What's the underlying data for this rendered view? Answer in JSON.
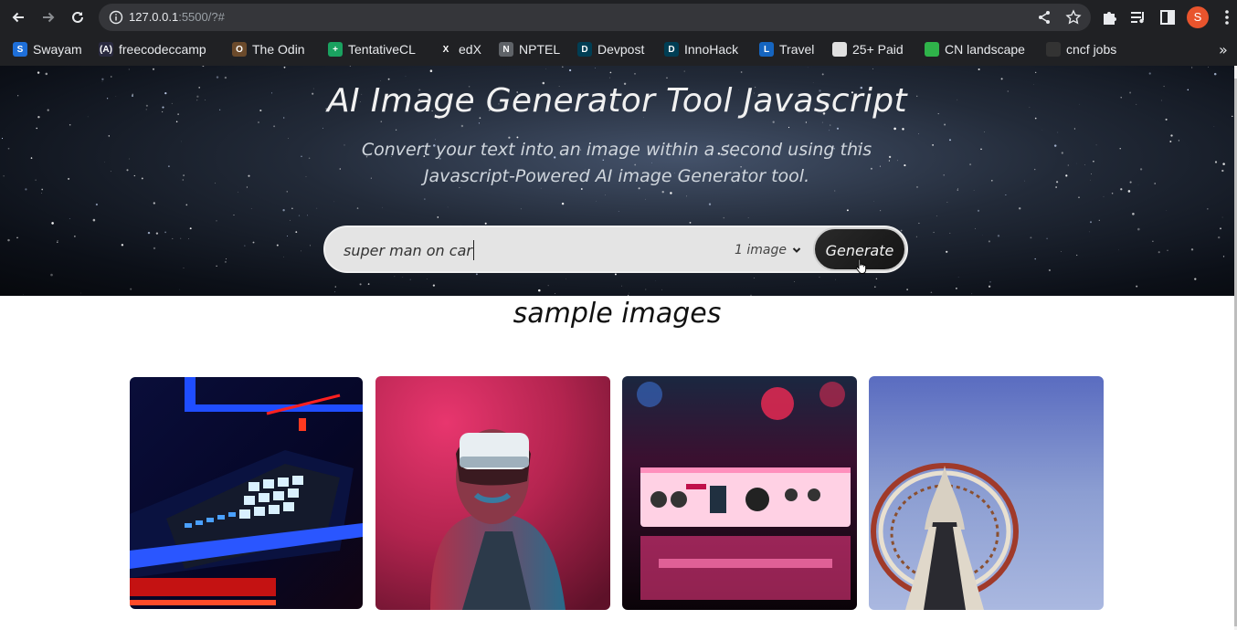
{
  "browser": {
    "url_host": "127.0.0.1",
    "url_rest": ":5500/?#",
    "profile_initial": "S",
    "icons": {
      "back": "back-arrow-icon",
      "forward": "forward-arrow-icon",
      "reload": "reload-icon",
      "info": "site-info-icon",
      "share": "share-icon",
      "bookmark": "star-icon",
      "extensions": "puzzle-icon",
      "media": "media-queue-icon",
      "sidepanel": "side-panel-icon",
      "menu": "kebab-menu-icon"
    },
    "bookmarks": [
      {
        "label": "Swayam",
        "icon": "swayam-icon",
        "color": "#1e6fd9",
        "glyph": "S"
      },
      {
        "label": "freecodeccamp",
        "icon": "freecodecamp-icon",
        "color": "#2a2a40",
        "glyph": "(A)"
      },
      {
        "label": "The Odin",
        "icon": "odin-icon",
        "color": "#6b4a2b",
        "glyph": "O"
      },
      {
        "label": "TentativeCL",
        "icon": "sheets-icon",
        "color": "#1aa260",
        "glyph": "+"
      },
      {
        "label": "edX",
        "icon": "edx-icon",
        "color": "#202124",
        "glyph": "X"
      },
      {
        "label": "NPTEL",
        "icon": "globe-icon",
        "color": "#5f6368",
        "glyph": "N"
      },
      {
        "label": "Devpost",
        "icon": "devpost-icon",
        "color": "#003e54",
        "glyph": "D"
      },
      {
        "label": "InnoHack",
        "icon": "devpost-icon",
        "color": "#003e54",
        "glyph": "D"
      },
      {
        "label": "Travel",
        "icon": "travel-icon",
        "color": "#1565c0",
        "glyph": "L"
      },
      {
        "label": "25+ Paid",
        "icon": "paid-icon",
        "color": "#e0e0e0",
        "glyph": ""
      },
      {
        "label": "CN landscape",
        "icon": "cncf-icon",
        "color": "#2fb34a",
        "glyph": ""
      },
      {
        "label": "cncf jobs",
        "icon": "cncf-jobs-icon",
        "color": "#333",
        "glyph": ""
      }
    ],
    "more_bookmarks": "»"
  },
  "hero": {
    "title": "AI Image Generator Tool Javascript",
    "subtitle": "Convert your text into an image within a second using this Javascript-Powered AI image Generator tool."
  },
  "search": {
    "value": "super man on car",
    "count_selected": "1 image",
    "generate_label": "Generate"
  },
  "gallery": {
    "title": "sample images",
    "images": [
      {
        "name": "sample-image-drum-machine",
        "subject": "drum machine under blue and red light"
      },
      {
        "name": "sample-image-vr-headset",
        "subject": "person wearing VR headset"
      },
      {
        "name": "sample-image-audio-interface",
        "subject": "audio interface with pink glow"
      },
      {
        "name": "sample-image-space-needle",
        "subject": "Space Needle tower"
      }
    ]
  }
}
